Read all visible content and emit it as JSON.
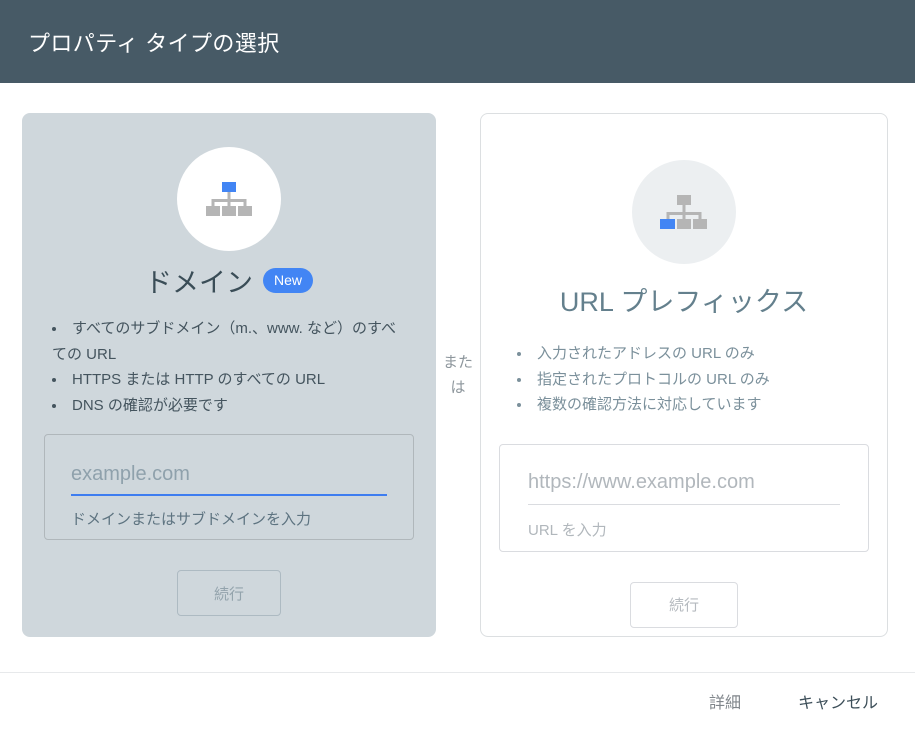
{
  "header": {
    "title": "プロパティ タイプの選択"
  },
  "or_label": "または",
  "cards": {
    "domain": {
      "icon": "sitemap-tree-icon",
      "title": "ドメイン",
      "badge": "New",
      "bullets": [
        "すべてのサブドメイン（m.、www. など）のすべての URL",
        "HTTPS または HTTP のすべての URL",
        "DNS の確認が必要です"
      ],
      "input_placeholder": "example.com",
      "input_value": "",
      "input_helper": "ドメインまたはサブドメインを入力",
      "continue_label": "続行"
    },
    "url_prefix": {
      "icon": "sitemap-tree-icon",
      "title": "URL プレフィックス",
      "bullets": [
        "入力されたアドレスの URL のみ",
        "指定されたプロトコルの URL のみ",
        "複数の確認方法に対応しています"
      ],
      "input_placeholder": "https://www.example.com",
      "input_value": "",
      "input_helper": "URL を入力",
      "continue_label": "続行"
    }
  },
  "footer": {
    "details_label": "詳細",
    "cancel_label": "キャンセル"
  },
  "colors": {
    "header_bg": "#475a66",
    "selected_card_bg": "#cfd7dc",
    "accent_blue": "#4285f4",
    "focus_underline": "#3e7df0",
    "icon_gray": "#b5b5b5",
    "card_border": "#dcdfe1"
  }
}
